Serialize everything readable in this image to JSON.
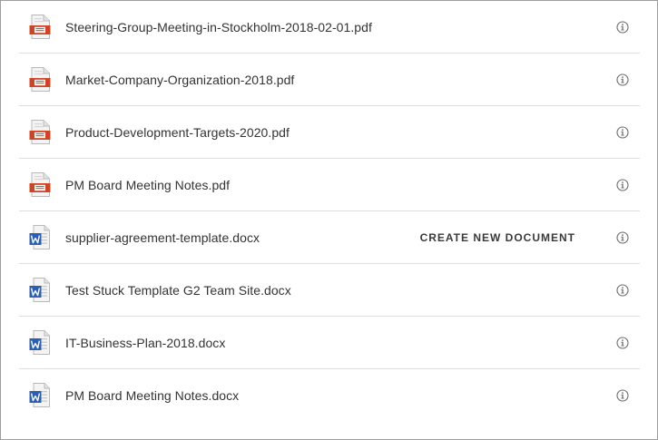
{
  "files": [
    {
      "name": "Steering-Group-Meeting-in-Stockholm-2018-02-01.pdf",
      "type": "pdf",
      "icon": "pdf-file-icon"
    },
    {
      "name": "Market-Company-Organization-2018.pdf",
      "type": "pdf",
      "icon": "pdf-file-icon"
    },
    {
      "name": "Product-Development-Targets-2020.pdf",
      "type": "pdf",
      "icon": "pdf-file-icon"
    },
    {
      "name": "PM Board Meeting Notes.pdf",
      "type": "pdf",
      "icon": "pdf-file-icon"
    },
    {
      "name": "supplier-agreement-template.docx",
      "type": "docx",
      "icon": "word-file-icon",
      "action": "CREATE NEW DOCUMENT"
    },
    {
      "name": "Test Stuck Template G2 Team Site.docx",
      "type": "docx",
      "icon": "word-file-icon"
    },
    {
      "name": "IT-Business-Plan-2018.docx",
      "type": "docx",
      "icon": "word-file-icon"
    },
    {
      "name": "PM Board Meeting Notes.docx",
      "type": "docx",
      "icon": "word-file-icon"
    }
  ],
  "info_icon": "info-circle-icon",
  "colors": {
    "pdf_accent": "#d04423",
    "word_accent": "#2b5fb4",
    "divider": "#dedede",
    "text": "#333333"
  }
}
